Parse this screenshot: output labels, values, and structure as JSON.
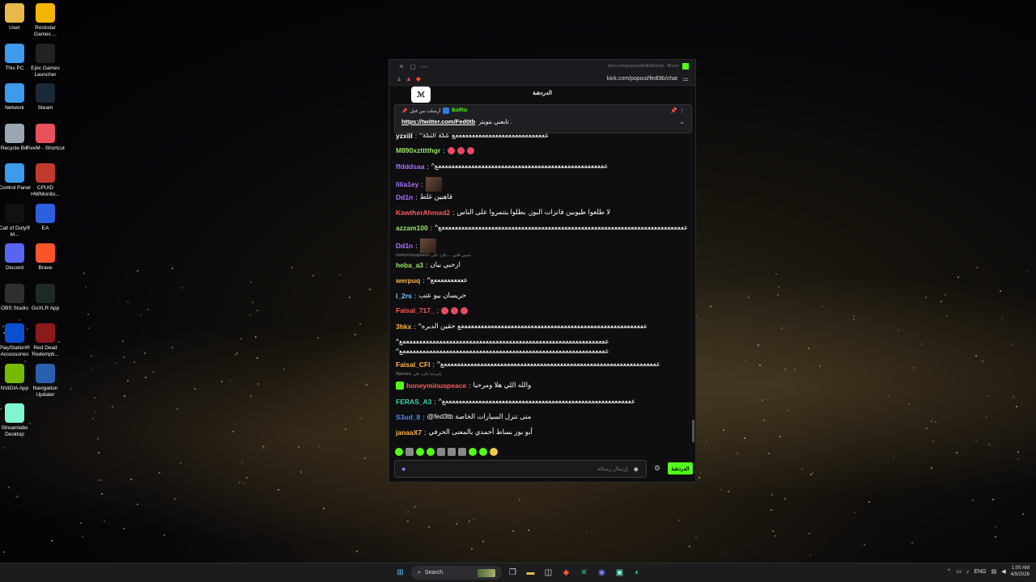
{
  "desktop": {
    "icons": [
      {
        "label": "User",
        "icon": "folder-icon",
        "color": "#e8b84a"
      },
      {
        "label": "Rockstar Games ...",
        "icon": "rockstar-icon",
        "color": "#f5b400"
      },
      {
        "label": "This PC",
        "icon": "monitor-icon",
        "color": "#3d9be9"
      },
      {
        "label": "Epic Games Launcher",
        "icon": "epic-icon",
        "color": "#222222"
      },
      {
        "label": "Network",
        "icon": "network-icon",
        "color": "#3d9be9"
      },
      {
        "label": "Steam",
        "icon": "steam-icon",
        "color": "#1b2838"
      },
      {
        "label": "Recycle Bin",
        "icon": "recycle-bin-icon",
        "color": "#9aa6b2"
      },
      {
        "label": "FiveM - Shortcut",
        "icon": "fivem-icon",
        "color": "#e8505b"
      },
      {
        "label": "Control Panel",
        "icon": "control-panel-icon",
        "color": "#3d9be9"
      },
      {
        "label": "CPUID HWMonito...",
        "icon": "cpuid-icon",
        "color": "#c0392b"
      },
      {
        "label": "Call of Duty® M...",
        "icon": "cod-icon",
        "color": "#111111"
      },
      {
        "label": "EA",
        "icon": "ea-icon",
        "color": "#2b5fde"
      },
      {
        "label": "Discord",
        "icon": "discord-icon",
        "color": "#5865f2"
      },
      {
        "label": "Brave",
        "icon": "brave-icon",
        "color": "#fb542b"
      },
      {
        "label": "OBS Studio",
        "icon": "obs-icon",
        "color": "#302e31"
      },
      {
        "label": "GoXLR App",
        "icon": "goxlr-icon",
        "color": "#1e2a28"
      },
      {
        "label": "PlayStation® Accessories",
        "icon": "playstation-icon",
        "color": "#0a4fcf"
      },
      {
        "label": "Red Dead Redempti...",
        "icon": "rdr-icon",
        "color": "#8b1a1a"
      },
      {
        "label": "NVIDIA App",
        "icon": "nvidia-icon",
        "color": "#76b900"
      },
      {
        "label": "Navigation Updater",
        "icon": "navigation-icon",
        "color": "#2a5fb0"
      },
      {
        "label": "Streamlabs Desktop",
        "icon": "streamlabs-icon",
        "color": "#80f5d2"
      }
    ]
  },
  "window": {
    "title": "kick.com/popout/fed0tb/chat - Brave",
    "url": "kick.com/popout/fed0tb/chat",
    "accent": "#53fc18"
  },
  "chat": {
    "header": "الدردشة",
    "logo_text": "ℳ",
    "pinned": {
      "meta": "أرسلت من قبل",
      "author": "BotRix",
      "link": "https://twitter.com/Fed0tb",
      "text": "تابعني بتويتر ."
    },
    "messages": [
      {
        "user": "yzxiil",
        "color": "#ffffff",
        "text": "^ععععععععععععععععععععععععععععع عكة التكة"
      },
      {
        "user": "M890xztttthgr",
        "color": "#9be66b",
        "emotes": 3
      },
      {
        "user": "ffdddsaa",
        "color": "#b070ff",
        "text": "^عععععععععععععععععععععععععععععععععععععععععععععععععععع"
      },
      {
        "user": "lilia1ey",
        "color": "#b070ff",
        "image": true
      },
      {
        "user": "Dd1n",
        "color": "#b070ff",
        "text": "قاهبين غلط"
      },
      {
        "user": "KawtherAhmad2",
        "color": "#ff5a5a",
        "text": "لا طلعوا طيوبين فانزات البوز, بطلوا يتنمروا على الناس"
      },
      {
        "user": "azzam100",
        "color": "#9be66b",
        "text": "^ععععععععععععععععععععععععععععععععععععععععععععععععععععععععععععععععععععععععععع"
      },
      {
        "user": "Dd1n",
        "color": "#b070ff",
        "image": true
      },
      {
        "reply": "honeyminuspeace: حبيبي قلبي ... بالرد على"
      },
      {
        "user": "heba_a3",
        "color": "#9be66b",
        "text": "ارحبي بيان"
      },
      {
        "user": "werpuq",
        "color": "#ffb347",
        "text": "^ععععععععععع"
      },
      {
        "user": "l_2rs",
        "color": "#7ec8ff",
        "text": "حريسان بيو عتب"
      },
      {
        "user": "Faisal_717_",
        "color": "#ff5a5a",
        "emotes": 3
      },
      {
        "user": "3hkx",
        "color": "#ffb347",
        "text": "^ععععععععععععععععععععععععععععععععععععععععععععععععععععععععع حقين الدبره"
      },
      {
        "cont": "^ععععععععععععععععععععععععععععععععععععععععععععععععععععععععععععععع"
      },
      {
        "cont": "^ععععععععععععععععععععععععععععععععععععععععععععععععععععععععععععععع"
      },
      {
        "user": "Faisal_CFI",
        "color": "#ffb347",
        "text": "^عععععععععععععععععععععععععععععععععععععععععععععععععععععععععععععععععع"
      },
      {
        "reply": "Aljohara: يامرحبا بالرد على"
      },
      {
        "user": "honeyminuspeace",
        "color": "#ff5a5a",
        "text": "والله اللي هلا ومرحبا",
        "badge": true
      },
      {
        "user": "FERAS_A3",
        "color": "#3ad6a8",
        "text": "^عععععععععععععععععععععععععععععععععععععععععععععععععععععععععع"
      },
      {
        "user": "S3ud_8",
        "color": "#4a8cff",
        "text": "@fed3tb متى تنزل السيارات الخاصة"
      },
      {
        "user": "janaaX7",
        "color": "#ffb347",
        "text": "أبو بوز بساط أحمدي بالمعنى الحرفي"
      }
    ],
    "input_placeholder": "إرسال رسالة",
    "send_label": "الدردشة"
  },
  "taskbar": {
    "search_label": "Search",
    "lang": "ENG",
    "time": "1:00 AM",
    "date": "4/9/2026"
  }
}
